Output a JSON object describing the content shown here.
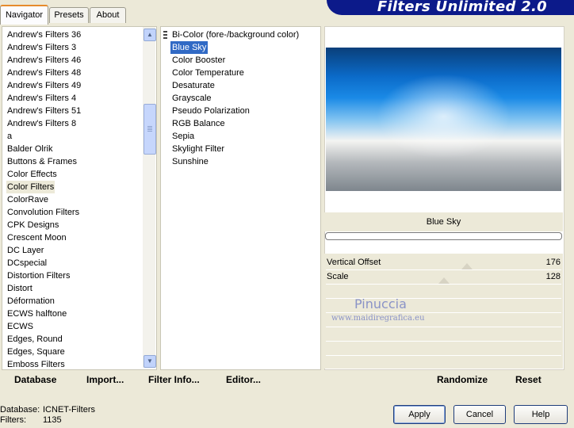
{
  "app": {
    "title": "Filters Unlimited 2.0"
  },
  "tabs": [
    {
      "label": "Navigator",
      "active": true
    },
    {
      "label": "Presets",
      "active": false
    },
    {
      "label": "About",
      "active": false
    }
  ],
  "categories": [
    "Andrew's Filters 36",
    "Andrew's Filters 3",
    "Andrew's Filters 46",
    "Andrew's Filters 48",
    "Andrew's Filters 49",
    "Andrew's Filters 4",
    "Andrew's Filters 51",
    "Andrew's Filters 8",
    "a",
    "Balder Olrik",
    "Buttons & Frames",
    "Color Effects",
    "Color Filters",
    "ColorRave",
    "Convolution Filters",
    "CPK Designs",
    "Crescent Moon",
    "DC Layer",
    "DCspecial",
    "Distortion Filters",
    "Distort",
    "Déformation",
    "ECWS halftone",
    "ECWS",
    "Edges, Round",
    "Edges, Square",
    "Emboss Filters"
  ],
  "selected_category": "Color Filters",
  "filters": [
    "Bi-Color (fore-/background color)",
    "Blue Sky",
    "Color Booster",
    "Color Temperature",
    "Desaturate",
    "Grayscale",
    "Pseudo Polarization",
    "RGB Balance",
    "Sepia",
    "Skylight Filter",
    "Sunshine"
  ],
  "selected_filter": "Blue Sky",
  "preview": {
    "filter_name": "Blue Sky"
  },
  "sliders": [
    {
      "label": "Vertical Offset",
      "value": "176",
      "max": 255
    },
    {
      "label": "Scale",
      "value": "128",
      "max": 255
    }
  ],
  "watermark": {
    "line1": "Pinuccia",
    "line2": "www.maidiregrafica.eu"
  },
  "toolbar": {
    "database": "Database",
    "import": "Import...",
    "filter_info": "Filter Info...",
    "editor": "Editor...",
    "randomize": "Randomize",
    "reset": "Reset"
  },
  "status": {
    "database_label": "Database:",
    "database_value": "ICNET-Filters",
    "filters_label": "Filters:",
    "filters_value": "1135"
  },
  "buttons": {
    "apply": "Apply",
    "cancel": "Cancel",
    "help": "Help"
  },
  "colors": {
    "accent": "#0c1a8a",
    "selection": "#316ac5",
    "tab_highlight": "#e68b2c"
  }
}
